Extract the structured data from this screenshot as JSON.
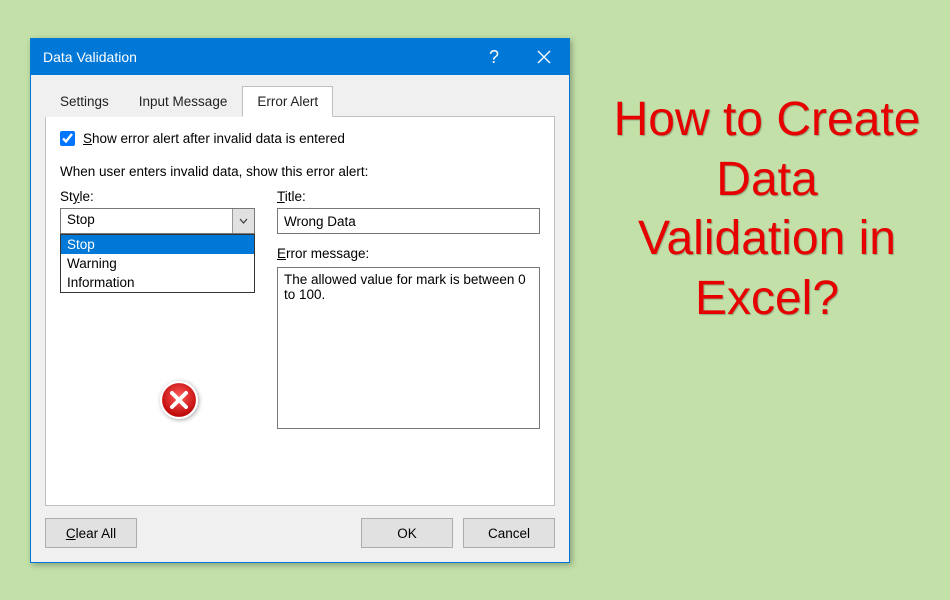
{
  "headline": "How to Create Data Validation in Excel?",
  "dialog": {
    "title": "Data Validation",
    "tabs": {
      "settings": "Settings",
      "inputMessage": "Input Message",
      "errorAlert": "Error Alert"
    },
    "checkbox": {
      "prefix": "S",
      "rest": "how error alert after invalid data is entered"
    },
    "prompt": "When user enters invalid data, show this error alert:",
    "style": {
      "label_under": "y",
      "label_pre": "St",
      "label_post": "le:",
      "value": "Stop",
      "options": {
        "0": "Stop",
        "1": "Warning",
        "2": "Information"
      }
    },
    "titleField": {
      "label_under": "T",
      "label_post": "itle:",
      "value": "Wrong Data"
    },
    "errorMsg": {
      "label_under": "E",
      "label_post": "rror message:",
      "value": "The allowed value for mark is between 0 to 100."
    },
    "buttons": {
      "clear_under": "C",
      "clear_rest": "lear All",
      "ok": "OK",
      "cancel": "Cancel"
    }
  }
}
